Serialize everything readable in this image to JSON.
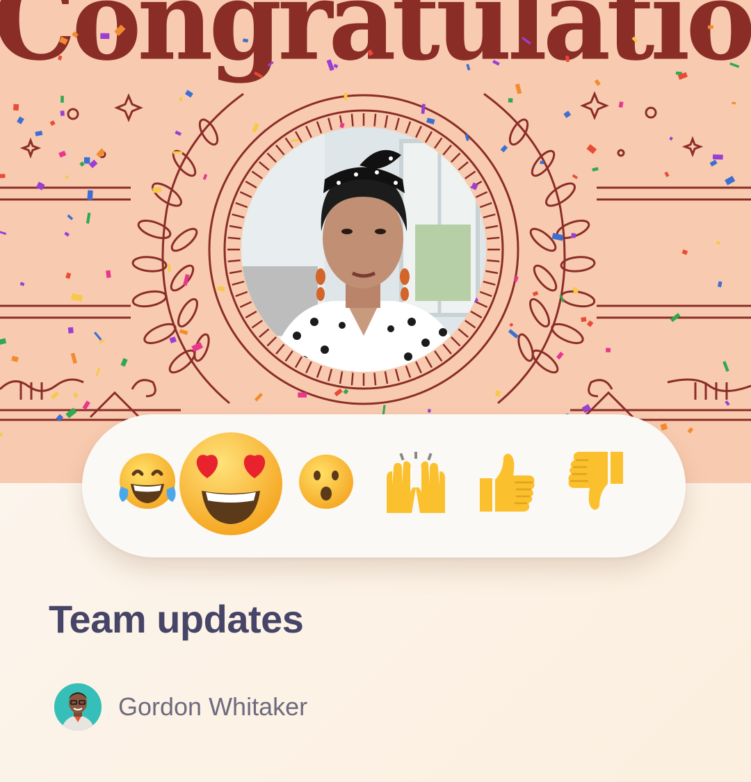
{
  "banner": {
    "headline": "Congratulations!",
    "background_color": "#f8cbb0",
    "ornament_color": "#8b2d27"
  },
  "portrait": {
    "icon": "presenter-portrait"
  },
  "reactions": [
    {
      "name": "tears-of-joy",
      "glyph": "😂",
      "icon": "tears-of-joy-icon"
    },
    {
      "name": "heart-eyes",
      "glyph": "😍",
      "icon": "heart-eyes-icon",
      "highlighted": true
    },
    {
      "name": "surprised",
      "glyph": "😮",
      "icon": "surprised-icon"
    },
    {
      "name": "raised-hands",
      "glyph": "🙌",
      "icon": "raised-hands-icon"
    },
    {
      "name": "thumbs-up",
      "glyph": "👍",
      "icon": "thumbs-up-icon"
    },
    {
      "name": "thumbs-down",
      "glyph": "👎",
      "icon": "thumbs-down-icon"
    }
  ],
  "post": {
    "title": "Team updates",
    "author": {
      "name": "Gordon Whitaker",
      "avatar_icon": "author-avatar"
    }
  },
  "colors": {
    "title": "#474567",
    "author": "#6d6b7e",
    "emoji_yellow": "#fbc02d"
  }
}
